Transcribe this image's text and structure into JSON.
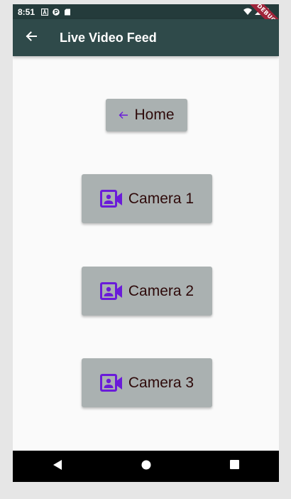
{
  "status_bar": {
    "time": "8:51",
    "debug_label": "DEBUG"
  },
  "app_bar": {
    "title": "Live Video Feed",
    "back_icon": "arrow-back-icon"
  },
  "buttons": {
    "home": {
      "label": "Home",
      "icon": "arrow-back-icon"
    },
    "camera1": {
      "label": "Camera 1",
      "icon": "video-camera-icon"
    },
    "camera2": {
      "label": "Camera 2",
      "icon": "video-camera-icon"
    },
    "camera3": {
      "label": "Camera 3",
      "icon": "video-camera-icon"
    }
  },
  "nav_bar": {
    "back_icon": "nav-back-icon",
    "home_icon": "nav-home-icon",
    "recents_icon": "nav-recents-icon"
  },
  "colors": {
    "app_bar": "#2f4a4a",
    "status_bar": "#243b3b",
    "button_bg": "#aab1b1",
    "button_text": "#2e0a0a",
    "icon_accent": "#6a1bd9",
    "debug_banner": "#a0243a"
  }
}
